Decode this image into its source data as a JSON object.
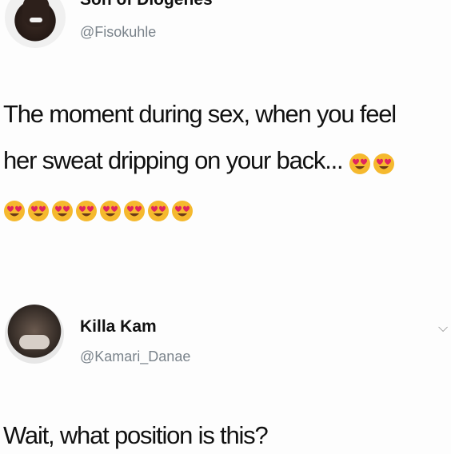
{
  "tweet": {
    "author": {
      "display_name": "Son of Diogenes",
      "handle": "@Fisokuhle",
      "avatar": "profile-photo"
    },
    "text_line_1": "The moment during sex, when you feel",
    "text_line_2": "her sweat dripping on your back...",
    "emojis_inline": [
      "smiling-face-with-heart-eyes",
      "smiling-face-with-heart-eyes"
    ],
    "emojis_row": [
      "smiling-face-with-heart-eyes",
      "smiling-face-with-heart-eyes",
      "smiling-face-with-heart-eyes",
      "smiling-face-with-heart-eyes",
      "smiling-face-with-heart-eyes",
      "smiling-face-with-heart-eyes",
      "smiling-face-with-heart-eyes",
      "smiling-face-with-heart-eyes"
    ]
  },
  "reply": {
    "author": {
      "display_name": "Killa Kam",
      "handle": "@Kamari_Danae",
      "avatar": "profile-photo"
    },
    "text": "Wait, what position is this?",
    "menu_icon": "chevron-down-icon"
  },
  "colors": {
    "text": "#111111",
    "handle": "#7a838b",
    "background": "#fdfdfd",
    "emoji_face": "#f5b92e",
    "emoji_heart": "#e0245e"
  }
}
